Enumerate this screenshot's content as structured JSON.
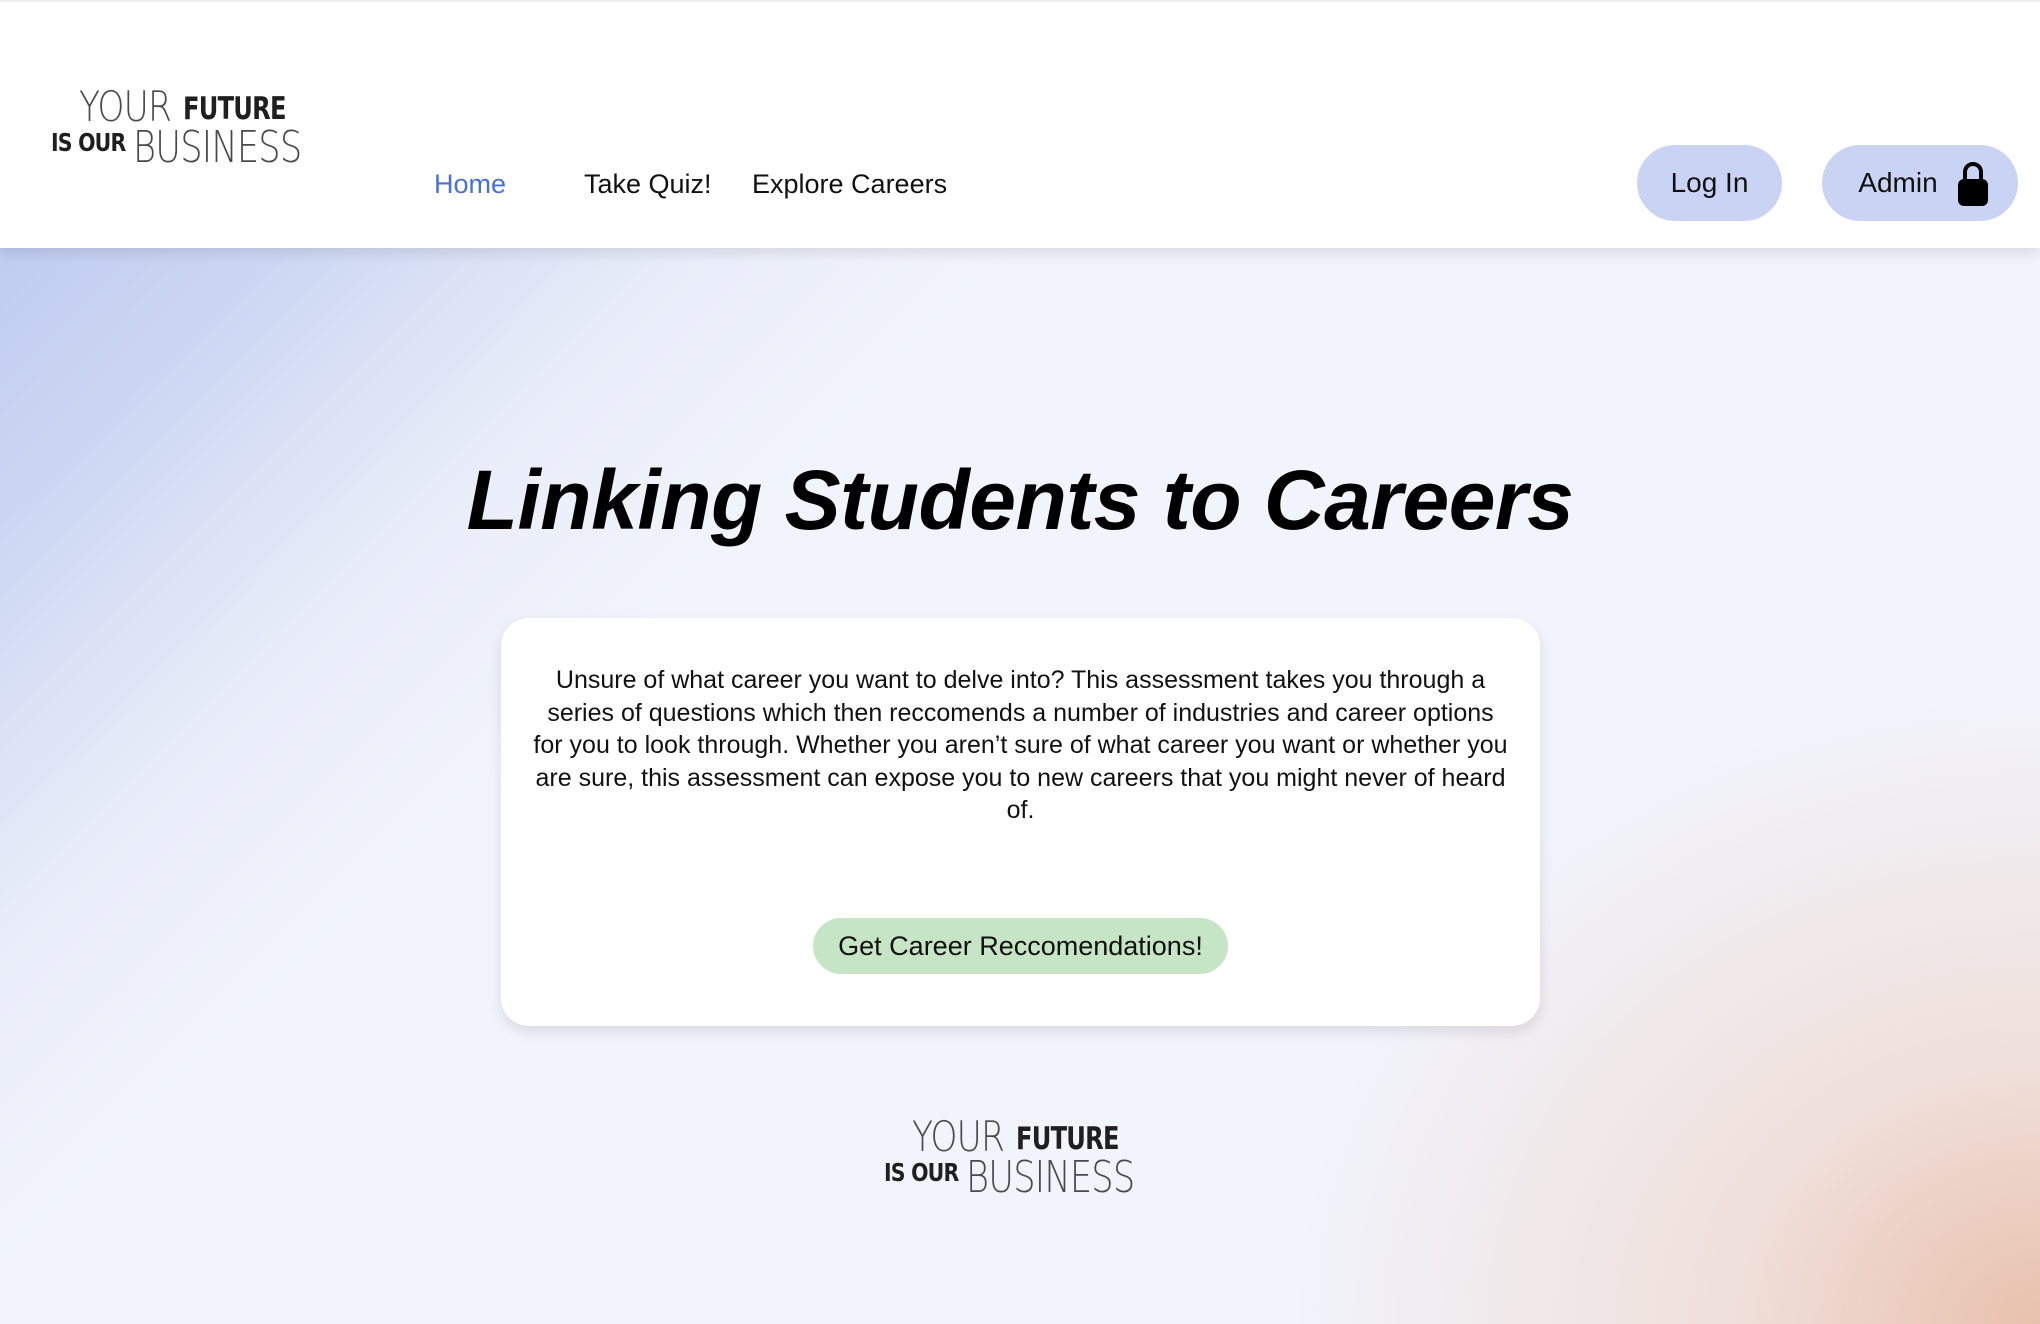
{
  "brand": {
    "logo_line1_a": "YOUR",
    "logo_line1_b": "FUTURE",
    "logo_line2_a": "IS OUR",
    "logo_line2_b": "BUSINESS"
  },
  "nav": {
    "items": [
      {
        "label": "Home",
        "active": true
      },
      {
        "label": "Take Quiz!",
        "active": false
      },
      {
        "label": "Explore Careers",
        "active": false
      }
    ],
    "active_color": "#4a6fd6"
  },
  "header_actions": {
    "login_label": "Log In",
    "admin_label": "Admin",
    "admin_icon": "lock-icon",
    "button_color": "#c9d3f3"
  },
  "hero": {
    "title": "Linking Students to Careers"
  },
  "card": {
    "description": "Unsure of what career you want to delve into? This assessment takes you through a series of questions which then reccomends a number of industries and career options for you to look through. Whether you aren’t sure of what career you want or whether you are sure, this assessment can expose you to new careers that you might never of heard of.",
    "cta_label": "Get Career Reccomendations!",
    "cta_color": "#c6e5c4"
  }
}
